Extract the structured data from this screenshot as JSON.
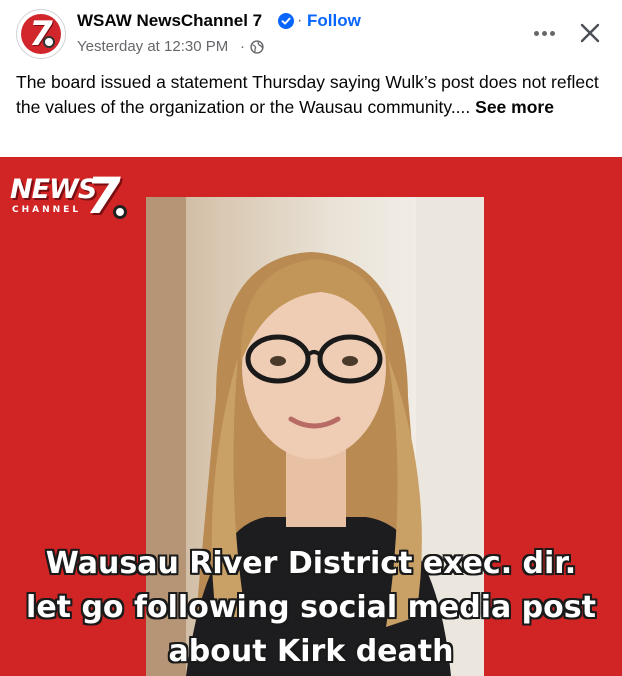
{
  "post": {
    "page_name": "WSAW NewsChannel 7",
    "follow_sep": "·",
    "follow_label": "Follow",
    "timestamp": "Yesterday at 12:30 PM",
    "timestamp_sep": "·",
    "text": "The board issued a statement Thursday saying Wulk’s post does not reflect the values of the organization or the Wausau community....",
    "see_more_label": "See more"
  },
  "icons": {
    "avatar": "wsaw-7-logo",
    "verified": "verified-badge-icon",
    "privacy": "globe-icon",
    "more": "more-options-icon",
    "close": "close-icon"
  },
  "media": {
    "logo_news": "NEWS",
    "logo_channel": "CHANNEL",
    "logo_number": "7",
    "caption_lines": [
      "Wausau River District exec. dir.",
      "let go following social media post",
      "about Kirk death"
    ],
    "background_color": "#d12424"
  },
  "colors": {
    "link": "#0866ff",
    "secondary_text": "#65676b",
    "primary_text": "#050505"
  }
}
